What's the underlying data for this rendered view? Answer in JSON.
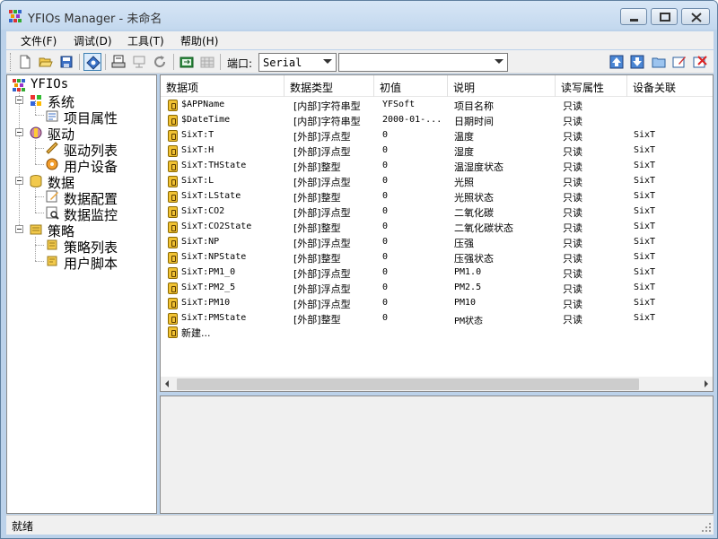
{
  "window": {
    "title": "YFIOs Manager - 未命名"
  },
  "menu": [
    {
      "label": "文件(F)"
    },
    {
      "label": "调试(D)"
    },
    {
      "label": "工具(T)"
    },
    {
      "label": "帮助(H)"
    }
  ],
  "toolbar": {
    "port_label": "端口:",
    "port_value": "Serial",
    "address_value": ""
  },
  "tree": {
    "root": "YFIOs",
    "groups": [
      {
        "label": "系统",
        "children": [
          "项目属性"
        ]
      },
      {
        "label": "驱动",
        "children": [
          "驱动列表",
          "用户设备"
        ]
      },
      {
        "label": "数据",
        "children": [
          "数据配置",
          "数据监控"
        ]
      },
      {
        "label": "策略",
        "children": [
          "策略列表",
          "用户脚本"
        ]
      }
    ]
  },
  "table": {
    "headers": [
      "数据项",
      "数据类型",
      "初值",
      "说明",
      "读写属性",
      "设备关联"
    ],
    "rows": [
      [
        "$APPName",
        "[内部]字符串型",
        "YFSoft",
        "项目名称",
        "只读",
        ""
      ],
      [
        "$DateTime",
        "[内部]字符串型",
        "2000-01-...",
        "日期时间",
        "只读",
        ""
      ],
      [
        "SixT:T",
        "[外部]浮点型",
        "0",
        "温度",
        "只读",
        "SixT"
      ],
      [
        "SixT:H",
        "[外部]浮点型",
        "0",
        "湿度",
        "只读",
        "SixT"
      ],
      [
        "SixT:THState",
        "[外部]整型",
        "0",
        "温湿度状态",
        "只读",
        "SixT"
      ],
      [
        "SixT:L",
        "[外部]浮点型",
        "0",
        "光照",
        "只读",
        "SixT"
      ],
      [
        "SixT:LState",
        "[外部]整型",
        "0",
        "光照状态",
        "只读",
        "SixT"
      ],
      [
        "SixT:CO2",
        "[外部]浮点型",
        "0",
        "二氧化碳",
        "只读",
        "SixT"
      ],
      [
        "SixT:CO2State",
        "[外部]整型",
        "0",
        "二氧化碳状态",
        "只读",
        "SixT"
      ],
      [
        "SixT:NP",
        "[外部]浮点型",
        "0",
        "压强",
        "只读",
        "SixT"
      ],
      [
        "SixT:NPState",
        "[外部]整型",
        "0",
        "压强状态",
        "只读",
        "SixT"
      ],
      [
        "SixT:PM1_0",
        "[外部]浮点型",
        "0",
        "PM1.0",
        "只读",
        "SixT"
      ],
      [
        "SixT:PM2_5",
        "[外部]浮点型",
        "0",
        "PM2.5",
        "只读",
        "SixT"
      ],
      [
        "SixT:PM10",
        "[外部]浮点型",
        "0",
        "PM10",
        "只读",
        "SixT"
      ],
      [
        "SixT:PMState",
        "[外部]整型",
        "0",
        "PM状态",
        "只读",
        "SixT"
      ]
    ],
    "new_item": "新建..."
  },
  "status": {
    "text": "就绪"
  }
}
